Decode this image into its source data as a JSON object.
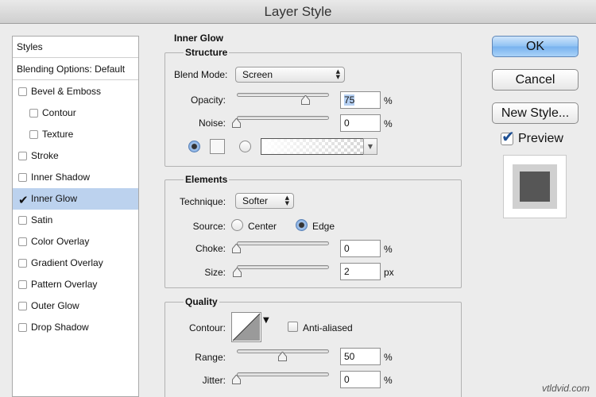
{
  "window": {
    "title": "Layer Style"
  },
  "sidebar": {
    "header": "Styles",
    "blending_options": "Blending Options: Default",
    "items": [
      {
        "label": "Bevel & Emboss",
        "checked": false,
        "indent": false
      },
      {
        "label": "Contour",
        "checked": false,
        "indent": true
      },
      {
        "label": "Texture",
        "checked": false,
        "indent": true
      },
      {
        "label": "Stroke",
        "checked": false,
        "indent": false
      },
      {
        "label": "Inner Shadow",
        "checked": false,
        "indent": false
      },
      {
        "label": "Inner Glow",
        "checked": true,
        "indent": false,
        "selected": true
      },
      {
        "label": "Satin",
        "checked": false,
        "indent": false
      },
      {
        "label": "Color Overlay",
        "checked": false,
        "indent": false
      },
      {
        "label": "Gradient Overlay",
        "checked": false,
        "indent": false
      },
      {
        "label": "Pattern Overlay",
        "checked": false,
        "indent": false
      },
      {
        "label": "Outer Glow",
        "checked": false,
        "indent": false
      },
      {
        "label": "Drop Shadow",
        "checked": false,
        "indent": false
      }
    ]
  },
  "panel": {
    "title": "Inner Glow",
    "structure": {
      "title": "Structure",
      "blend_mode_label": "Blend Mode:",
      "blend_mode_value": "Screen",
      "opacity_label": "Opacity:",
      "opacity_value": "75",
      "opacity_level": 0.75,
      "opacity_unit": "%",
      "noise_label": "Noise:",
      "noise_value": "0",
      "noise_level": 0,
      "noise_unit": "%",
      "fill_mode": "color"
    },
    "elements": {
      "title": "Elements",
      "technique_label": "Technique:",
      "technique_value": "Softer",
      "source_label": "Source:",
      "source_center": "Center",
      "source_edge": "Edge",
      "source_selected": "edge",
      "choke_label": "Choke:",
      "choke_value": "0",
      "choke_level": 0,
      "choke_unit": "%",
      "size_label": "Size:",
      "size_value": "2",
      "size_level": 0.01,
      "size_unit": "px"
    },
    "quality": {
      "title": "Quality",
      "contour_label": "Contour:",
      "anti_aliased_label": "Anti-aliased",
      "anti_aliased_checked": false,
      "range_label": "Range:",
      "range_value": "50",
      "range_level": 0.5,
      "range_unit": "%",
      "jitter_label": "Jitter:",
      "jitter_value": "0",
      "jitter_level": 0,
      "jitter_unit": "%"
    }
  },
  "buttons": {
    "ok": "OK",
    "cancel": "Cancel",
    "new_style": "New Style...",
    "preview_label": "Preview",
    "preview_checked": true
  },
  "colors": {
    "accent": "#78b2ee",
    "selection": "#bcd2ee",
    "preview_square": "#565656"
  },
  "watermark": "vtldvid.com"
}
